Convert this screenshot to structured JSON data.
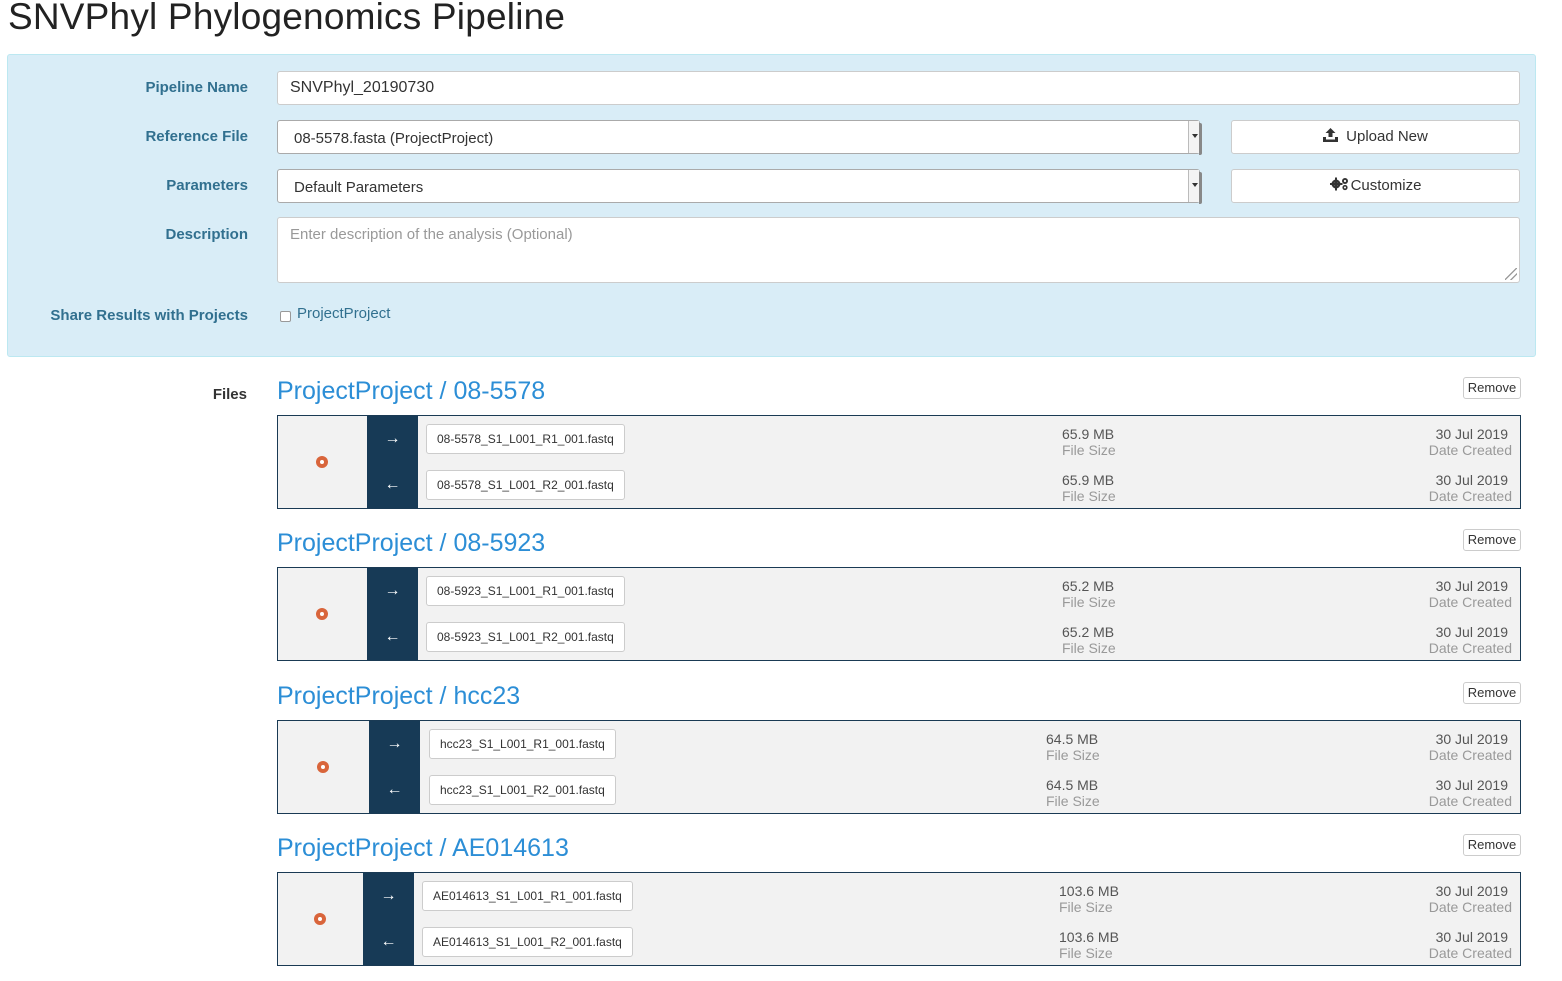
{
  "page_title": "SNVPhyl Phylogenomics Pipeline",
  "form": {
    "pipeline_name_label": "Pipeline Name",
    "pipeline_name_value": "SNVPhyl_20190730",
    "reference_file_label": "Reference File",
    "reference_file_value": "08-5578.fasta (ProjectProject)",
    "upload_new_label": "Upload New",
    "parameters_label": "Parameters",
    "parameters_value": "Default Parameters",
    "customize_label": "Customize",
    "description_label": "Description",
    "description_placeholder": "Enter description of the analysis (Optional)",
    "share_label": "Share Results with Projects",
    "share_project": "ProjectProject"
  },
  "files_label": "Files",
  "remove_label": "Remove",
  "file_size_label": "File Size",
  "date_created_label": "Date Created",
  "samples": [
    {
      "title": "ProjectProject / 08-5578",
      "files": [
        {
          "direction": "forward",
          "name": "08-5578_S1_L001_R1_001.fastq",
          "size": "65.9 MB",
          "date": "30 Jul 2019"
        },
        {
          "direction": "reverse",
          "name": "08-5578_S1_L001_R2_001.fastq",
          "size": "65.9 MB",
          "date": "30 Jul 2019"
        }
      ]
    },
    {
      "title": "ProjectProject / 08-5923",
      "files": [
        {
          "direction": "forward",
          "name": "08-5923_S1_L001_R1_001.fastq",
          "size": "65.2 MB",
          "date": "30 Jul 2019"
        },
        {
          "direction": "reverse",
          "name": "08-5923_S1_L001_R2_001.fastq",
          "size": "65.2 MB",
          "date": "30 Jul 2019"
        }
      ]
    },
    {
      "title": "ProjectProject / hcc23",
      "files": [
        {
          "direction": "forward",
          "name": "hcc23_S1_L001_R1_001.fastq",
          "size": "64.5 MB",
          "date": "30 Jul 2019"
        },
        {
          "direction": "reverse",
          "name": "hcc23_S1_L001_R2_001.fastq",
          "size": "64.5 MB",
          "date": "30 Jul 2019"
        }
      ]
    },
    {
      "title": "ProjectProject / AE014613",
      "files": [
        {
          "direction": "forward",
          "name": "AE014613_S1_L001_R1_001.fastq",
          "size": "103.6 MB",
          "date": "30 Jul 2019"
        },
        {
          "direction": "reverse",
          "name": "AE014613_S1_L001_R2_001.fastq",
          "size": "103.6 MB",
          "date": "30 Jul 2019"
        }
      ]
    }
  ],
  "colors": {
    "panel_bg": "#d9edf7",
    "label": "#31708f",
    "sample_title": "#2c8ed6",
    "arrow_col": "#173a56",
    "radio": "#d9653b"
  },
  "icons": {
    "forward": "arrow-right-icon",
    "reverse": "arrow-left-icon",
    "upload": "upload-icon",
    "customize": "gears-icon"
  }
}
